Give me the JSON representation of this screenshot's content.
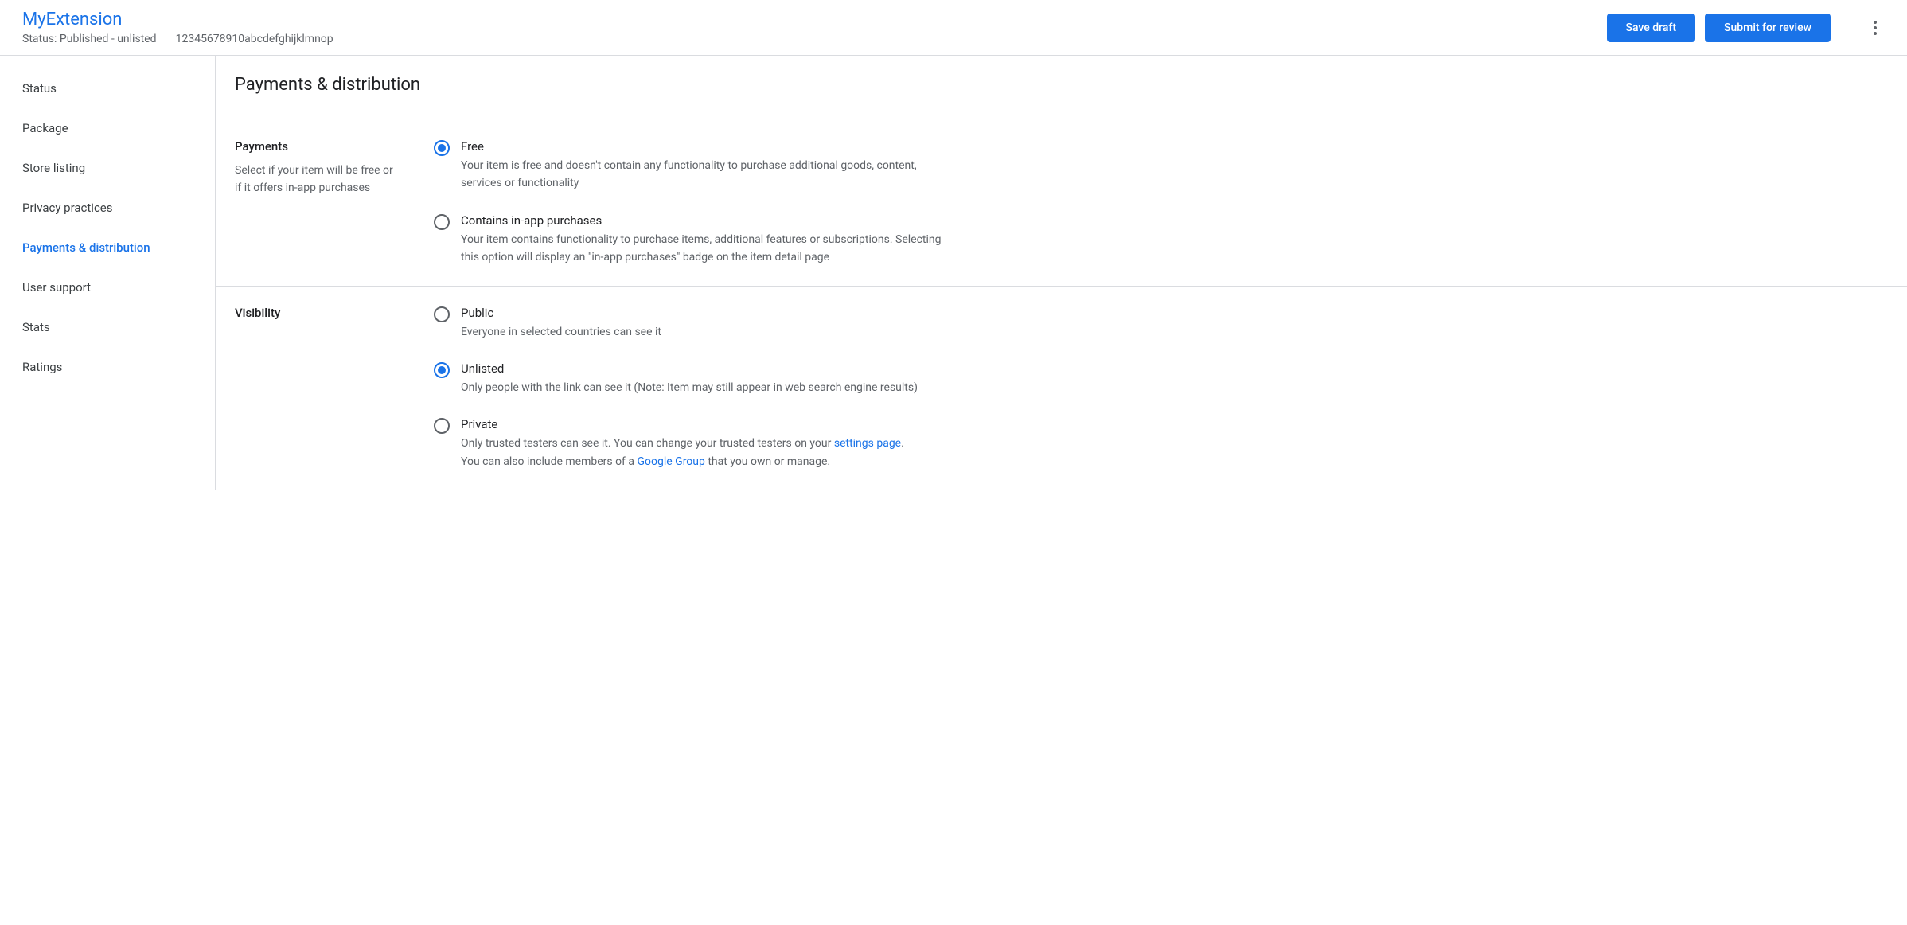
{
  "header": {
    "title": "MyExtension",
    "status_prefix": "Status: ",
    "status_value": "Published - unlisted",
    "item_id": "12345678910abcdefghijklmnop",
    "save_draft_label": "Save draft",
    "submit_label": "Submit for review"
  },
  "sidebar": {
    "items": [
      {
        "label": "Status",
        "active": false
      },
      {
        "label": "Package",
        "active": false
      },
      {
        "label": "Store listing",
        "active": false
      },
      {
        "label": "Privacy practices",
        "active": false
      },
      {
        "label": "Payments & distribution",
        "active": true
      },
      {
        "label": "User support",
        "active": false
      },
      {
        "label": "Stats",
        "active": false
      },
      {
        "label": "Ratings",
        "active": false
      }
    ]
  },
  "main": {
    "page_title": "Payments & distribution",
    "sections": {
      "payments": {
        "title": "Payments",
        "description": "Select if your item will be free or if it offers in-app purchases",
        "options": {
          "free": {
            "title": "Free",
            "description": "Your item is free and doesn't contain any functionality to purchase additional goods, content, services or functionality"
          },
          "inapp": {
            "title": "Contains in-app purchases",
            "description": "Your item contains functionality to purchase items, additional features or subscriptions. Selecting this option will display an \"in-app purchases\" badge on the item detail page"
          }
        }
      },
      "visibility": {
        "title": "Visibility",
        "options": {
          "public": {
            "title": "Public",
            "description": "Everyone in selected countries can see it"
          },
          "unlisted": {
            "title": "Unlisted",
            "description": "Only people with the link can see it (Note: Item may still appear in web search engine results)"
          },
          "private": {
            "title": "Private",
            "desc_part1": "Only trusted testers can see it. You can change your trusted testers on your ",
            "link1": "settings page",
            "desc_part2": ".",
            "desc_part3": "You can also include members of a ",
            "link2": "Google Group",
            "desc_part4": " that you own or manage."
          }
        }
      }
    }
  }
}
